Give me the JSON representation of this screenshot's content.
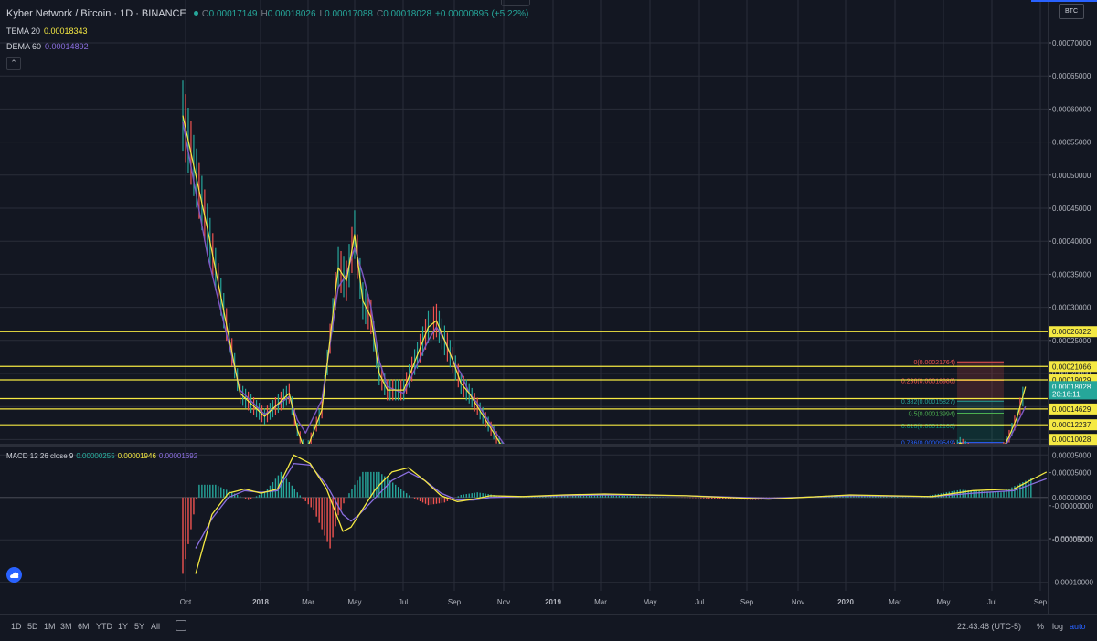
{
  "header": {
    "symbol": "Kyber Network / Bitcoin · 1D · BINANCE",
    "o_label": "O",
    "o_value": "0.00017149",
    "h_label": "H",
    "h_value": "0.00018026",
    "l_label": "L",
    "l_value": "0.00017088",
    "c_label": "C",
    "c_value": "0.00018028",
    "change": "+0.00000895 (+5.22%)"
  },
  "indicators": [
    {
      "name": "TEMA 20",
      "value": "0.00018343"
    },
    {
      "name": "DEMA 60",
      "value": "0.00014892"
    }
  ],
  "collapse_icon": "chevron-up-icon",
  "currency_badge": "BTC",
  "colors": {
    "background": "#131722",
    "grid": "#2a2e39",
    "up": "#26a69a",
    "down": "#ef5350",
    "tema": "#f5e943",
    "dema": "#7e57c2",
    "hline": "#f5e943",
    "accent": "#2962ff",
    "macd_line": "#f5e943",
    "signal_line": "#8b6fe0"
  },
  "chart_data": [
    {
      "type": "line",
      "title": "",
      "x_ticks": [
        "Oct",
        "2018",
        "Mar",
        "May",
        "Jul",
        "Sep",
        "Nov",
        "2019",
        "Mar",
        "May",
        "Jul",
        "Sep",
        "Nov",
        "2020",
        "Mar",
        "May",
        "Jul",
        "Sep"
      ],
      "ylim": [
        -6e-05,
        0.00073
      ],
      "y_ticks": [
        "0.00070000",
        "0.00065000",
        "0.00060000",
        "0.00055000",
        "0.00050000",
        "0.00045000",
        "0.00040000",
        "0.00035000",
        "0.00030000",
        "0.00025000",
        "0.00020000",
        "0.00015000",
        "0.00010000",
        "0.00005000",
        "-0.00000000",
        "-0.00005000"
      ],
      "price_labels": [
        {
          "text": "0.00026322",
          "kind": "level"
        },
        {
          "text": "0.00021066",
          "kind": "level"
        },
        {
          "text": "0.00019029",
          "kind": "level"
        },
        {
          "text": "0.00018028",
          "kind": "last"
        },
        {
          "text": "20:16:11",
          "kind": "countdown"
        },
        {
          "text": "0.00014629",
          "kind": "level"
        },
        {
          "text": "0.00012237",
          "kind": "level"
        },
        {
          "text": "0.00010028",
          "kind": "level"
        }
      ],
      "horizontal_levels": [
        0.00026322,
        0.00021066,
        0.00019029,
        0.000162,
        0.00014629,
        0.00012237
      ],
      "fib_levels": [
        {
          "label": "0(0.00021764)",
          "value": 0.00021764
        },
        {
          "label": "0.236(0.00018986)",
          "value": 0.00018986
        },
        {
          "label": "0.382(0.00015827)",
          "value": 0.00015827
        },
        {
          "label": "0.5(0.00013994)",
          "value": 0.00013994
        },
        {
          "label": "0.618(0.00012160)",
          "value": 0.0001216
        },
        {
          "label": "0.786(0.00009549)",
          "value": 9.549e-05
        },
        {
          "label": "1.618(-0.00003365)",
          "value": -3.365e-05
        }
      ],
      "series": [
        {
          "name": "TEMA 20",
          "x": [
            0,
            3,
            7,
            10,
            13,
            14,
            15,
            17,
            19,
            20,
            21,
            22,
            23,
            24,
            25,
            27,
            30,
            31,
            32,
            33,
            34,
            35,
            36,
            38,
            40,
            42,
            45,
            49,
            53,
            58,
            62,
            65,
            67,
            69,
            71,
            74,
            80,
            85,
            89,
            92,
            95,
            97,
            99,
            100,
            101,
            102,
            103
          ],
          "y": [
            0.00059,
            0.00042,
            0.00017,
            0.000135,
            0.00017,
            0.000115,
            8e-05,
            0.000145,
            0.00036,
            0.00034,
            0.00041,
            0.00031,
            0.000285,
            0.0002,
            0.000175,
            0.000175,
            0.00027,
            0.00028,
            0.00025,
            0.00022,
            0.000185,
            0.00017,
            0.00015,
            0.00011,
            7e-05,
            6e-05,
            4.5e-05,
            4e-05,
            4e-05,
            4e-05,
            5.5e-05,
            6e-05,
            4e-05,
            3e-05,
            2e-05,
            1e-05,
            1e-05,
            1.5e-05,
            3e-05,
            6e-05,
            9.5e-05,
            8e-05,
            8.5e-05,
            8e-05,
            0.000105,
            0.000135,
            0.00018
          ]
        },
        {
          "name": "DEMA 60",
          "x": [
            0,
            3,
            7,
            10,
            13,
            14,
            15,
            17,
            19,
            20,
            21,
            22,
            23,
            24,
            25,
            27,
            30,
            31,
            32,
            33,
            34,
            35,
            36,
            38,
            40,
            42,
            45,
            49,
            53,
            58,
            62,
            65,
            67,
            69,
            71,
            74,
            80,
            85,
            89,
            92,
            95,
            97,
            99,
            100,
            101,
            102,
            103
          ],
          "y": [
            0.00058,
            0.00038,
            0.000175,
            0.000138,
            0.000165,
            0.00013,
            0.00011,
            0.00016,
            0.00033,
            0.00035,
            0.00039,
            0.00035,
            0.0003,
            0.00022,
            0.00018,
            0.00017,
            0.00025,
            0.00027,
            0.00025,
            0.00022,
            0.0002,
            0.00017,
            0.000155,
            0.000115,
            8e-05,
            6e-05,
            5e-05,
            4e-05,
            4e-05,
            4e-05,
            5e-05,
            5.5e-05,
            4e-05,
            3e-05,
            2e-05,
            1e-05,
            1e-05,
            1.5e-05,
            2.8e-05,
            5e-05,
            8e-05,
            8e-05,
            8e-05,
            8e-05,
            0.0001,
            0.000125,
            0.00015
          ]
        }
      ]
    },
    {
      "type": "line",
      "title": "MACD",
      "legend": {
        "name": "MACD 12 26 close 9",
        "macd": "0.00000255",
        "signal": "0.00001946",
        "histogram": "0.00001692"
      },
      "ylim": [
        -0.00011,
        6e-05
      ],
      "y_ticks": [
        "0.00005000",
        "0.00000000",
        "-0.00005000",
        "-0.00010000"
      ],
      "series": [
        {
          "name": "MACD",
          "x": [
            0,
            2,
            4,
            6,
            8,
            10,
            12,
            14,
            16,
            18,
            19,
            20,
            22,
            24,
            26,
            28,
            30,
            32,
            34,
            36,
            40,
            45,
            50,
            60,
            70,
            80,
            90,
            95,
            100,
            102,
            104
          ],
          "y": [
            -9e-05,
            -2e-05,
            5e-06,
            1e-05,
            5e-06,
            1e-05,
            5e-05,
            4e-05,
            1e-05,
            -4e-05,
            -3.5e-05,
            -2e-05,
            1e-05,
            3e-05,
            3.5e-05,
            2e-05,
            2e-06,
            -5e-06,
            -2e-06,
            2e-06,
            1e-06,
            3e-06,
            4e-06,
            2e-06,
            -2e-06,
            3e-06,
            1e-06,
            8e-06,
            1e-05,
            2e-05,
            3e-05
          ]
        },
        {
          "name": "Signal",
          "x": [
            0,
            2,
            4,
            6,
            8,
            10,
            12,
            14,
            16,
            18,
            19,
            20,
            22,
            24,
            26,
            28,
            30,
            32,
            34,
            36,
            40,
            45,
            50,
            60,
            70,
            80,
            90,
            95,
            100,
            102,
            104
          ],
          "y": [
            -6e-05,
            -2.5e-05,
            0.0,
            8e-06,
            6e-06,
            8e-06,
            4e-05,
            3.8e-05,
            1.5e-05,
            -2e-05,
            -2.8e-05,
            -2e-05,
            0.0,
            2e-05,
            3e-05,
            2e-05,
            5e-06,
            -3e-06,
            -3e-06,
            0.0,
            1e-06,
            2e-06,
            3e-06,
            2e-06,
            -1e-06,
            2e-06,
            1e-06,
            5e-06,
            8e-06,
            1.5e-05,
            2.2e-05
          ]
        }
      ]
    }
  ],
  "bottom_bar": {
    "timeframes": [
      "1D",
      "5D",
      "1M",
      "3M",
      "6M",
      "YTD",
      "1Y",
      "5Y",
      "All"
    ],
    "calendar_icon": "calendar-range-icon",
    "time": "22:43:48 (UTC-5)",
    "percent": "%",
    "log": "log",
    "auto": "auto"
  }
}
